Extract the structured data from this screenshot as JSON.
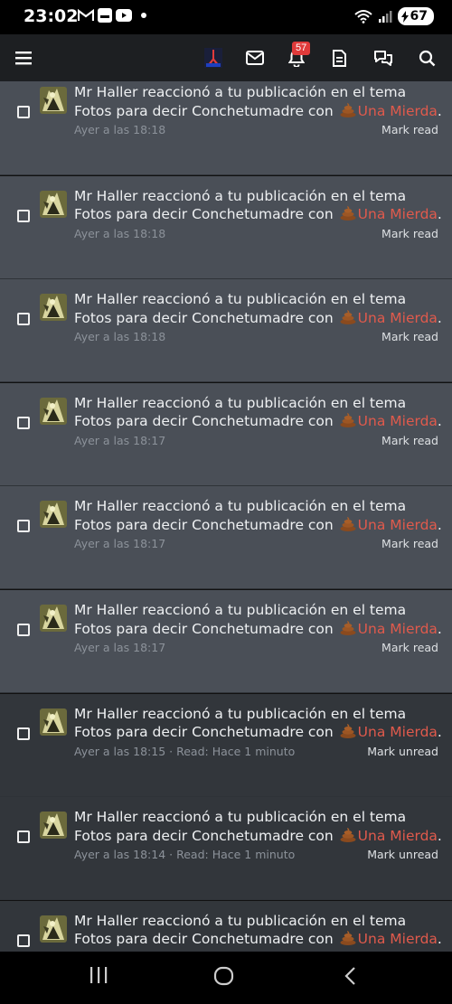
{
  "status_bar": {
    "time": "23:02",
    "battery": "67",
    "app_icons": [
      "gmail-icon",
      "chat-icon",
      "youtube-icon"
    ]
  },
  "nav": {
    "notification_count": "57"
  },
  "notifications": [
    {
      "user": "Mr Haller",
      "text_pre": " reaccionó a tu publicación en el tema ",
      "topic": "Fotos",
      "text_mid": " para decir ",
      "tag": "Conchetumadre",
      "text_con": " con ",
      "reaction": "Una Mierda",
      "period": ".",
      "time": "Ayer a las 18:18",
      "read_info": "",
      "action": "Mark read",
      "state": "unread"
    },
    {
      "user": "Mr Haller",
      "text_pre": " reaccionó a tu publicación en el tema ",
      "topic": "Fotos",
      "text_mid": " para decir ",
      "tag": "Conchetumadre",
      "text_con": " con ",
      "reaction": "Una Mierda",
      "period": ".",
      "time": "Ayer a las 18:18",
      "read_info": "",
      "action": "Mark read",
      "state": "unread"
    },
    {
      "user": "Mr Haller",
      "text_pre": " reaccionó a tu publicación en el tema ",
      "topic": "Fotos",
      "text_mid": " para decir ",
      "tag": "Conchetumadre",
      "text_con": " con ",
      "reaction": "Una Mierda",
      "period": ".",
      "time": "Ayer a las 18:18",
      "read_info": "",
      "action": "Mark read",
      "state": "unread"
    },
    {
      "user": "Mr Haller",
      "text_pre": " reaccionó a tu publicación en el tema ",
      "topic": "Fotos",
      "text_mid": " para decir ",
      "tag": "Conchetumadre",
      "text_con": " con ",
      "reaction": "Una Mierda",
      "period": ".",
      "time": "Ayer a las 18:17",
      "read_info": "",
      "action": "Mark read",
      "state": "unread"
    },
    {
      "user": "Mr Haller",
      "text_pre": " reaccionó a tu publicación en el tema ",
      "topic": "Fotos",
      "text_mid": " para decir ",
      "tag": "Conchetumadre",
      "text_con": " con ",
      "reaction": "Una Mierda",
      "period": ".",
      "time": "Ayer a las 18:17",
      "read_info": "",
      "action": "Mark read",
      "state": "unread"
    },
    {
      "user": "Mr Haller",
      "text_pre": " reaccionó a tu publicación en el tema ",
      "topic": "Fotos",
      "text_mid": " para decir ",
      "tag": "Conchetumadre",
      "text_con": " con ",
      "reaction": "Una Mierda",
      "period": ".",
      "time": "Ayer a las 18:17",
      "read_info": "",
      "action": "Mark read",
      "state": "unread"
    },
    {
      "user": "Mr Haller",
      "text_pre": " reaccionó a tu publicación en el tema ",
      "topic": "Fotos",
      "text_mid": " para decir ",
      "tag": "Conchetumadre",
      "text_con": " con ",
      "reaction": "Una Mierda",
      "period": ".",
      "time": "Ayer a las 18:15",
      "read_info": " · Read: Hace 1 minuto",
      "action": "Mark unread",
      "state": "read"
    },
    {
      "user": "Mr Haller",
      "text_pre": " reaccionó a tu publicación en el tema ",
      "topic": "Fotos",
      "text_mid": " para decir ",
      "tag": "Conchetumadre",
      "text_con": " con ",
      "reaction": "Una Mierda",
      "period": ".",
      "time": "Ayer a las 18:14",
      "read_info": " · Read: Hace 1 minuto",
      "action": "Mark unread",
      "state": "read"
    },
    {
      "user": "Mr Haller",
      "text_pre": " reaccionó a tu publicación en el tema ",
      "topic": "Fotos",
      "text_mid": " para decir ",
      "tag": "Conchetumadre",
      "text_con": " con ",
      "reaction": "Una Mierda",
      "period": ".",
      "time": "",
      "read_info": "",
      "action": "",
      "state": "read"
    }
  ],
  "colors": {
    "unread_bg": "#4a4f57",
    "read_bg": "#32363b",
    "reaction_red": "#e05a4c",
    "badge_red": "#e03a3a"
  }
}
